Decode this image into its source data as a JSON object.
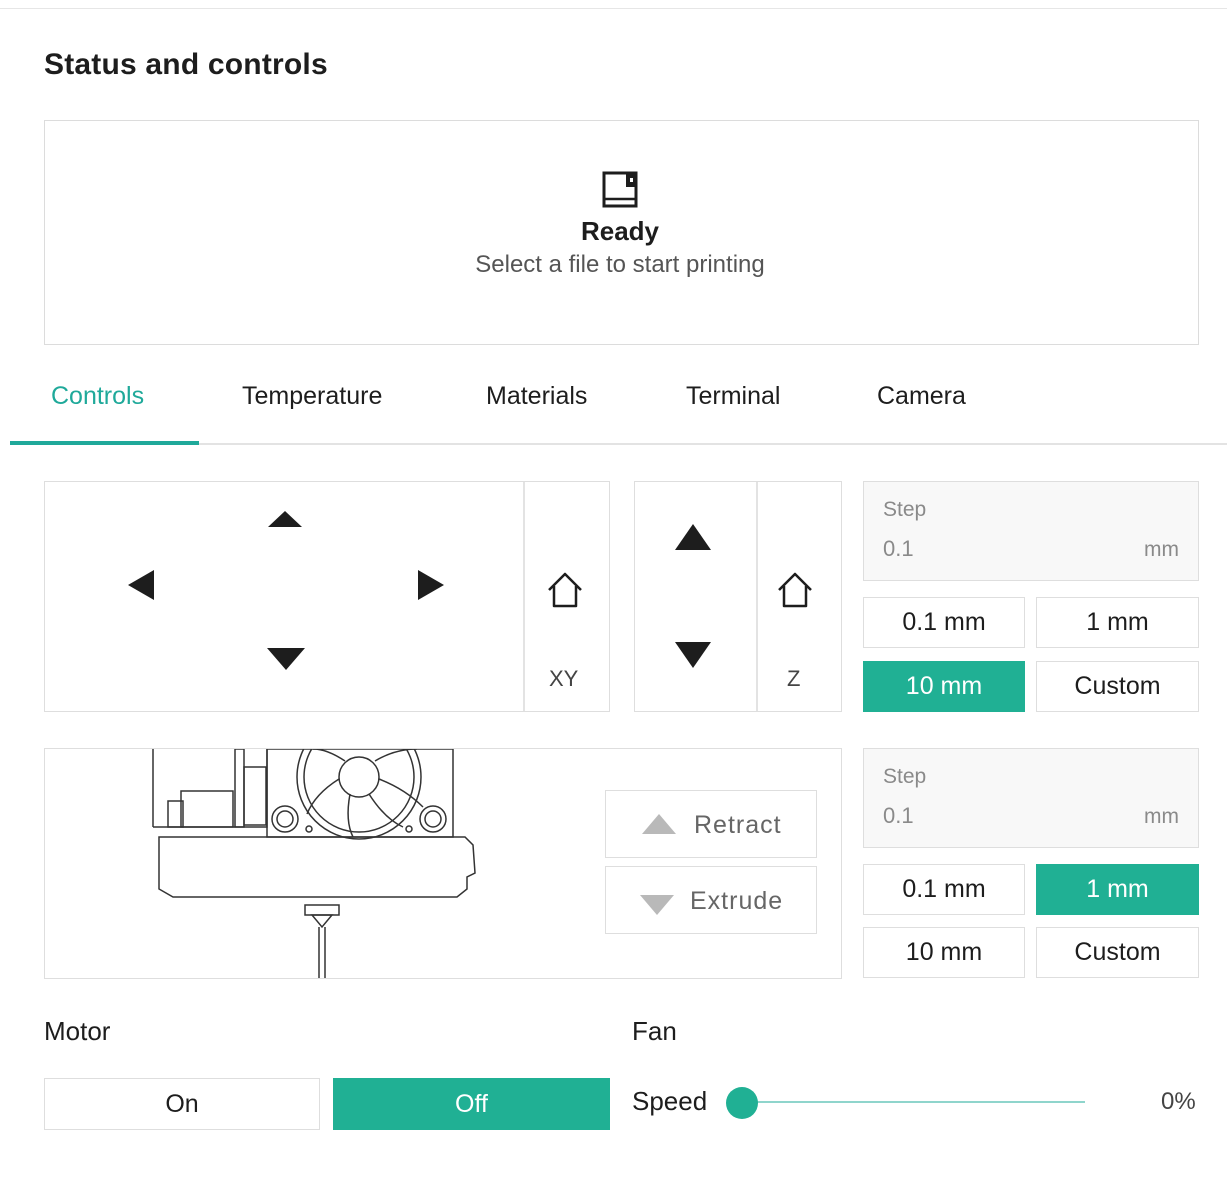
{
  "page": {
    "title": "Status and controls"
  },
  "status": {
    "title": "Ready",
    "subtitle": "Select a file to start printing",
    "icon": "printer-icon"
  },
  "tabs": [
    {
      "label": "Controls",
      "active": true
    },
    {
      "label": "Temperature",
      "active": false
    },
    {
      "label": "Materials",
      "active": false
    },
    {
      "label": "Terminal",
      "active": false
    },
    {
      "label": "Camera",
      "active": false
    }
  ],
  "xy_jog": {
    "home_label": "XY"
  },
  "z_jog": {
    "home_label": "Z"
  },
  "move_step": {
    "label": "Step",
    "value": "0.1",
    "unit": "mm",
    "options": [
      "0.1 mm",
      "1 mm",
      "10 mm",
      "Custom"
    ],
    "selected": "10 mm"
  },
  "extruder": {
    "retract_label": "Retract",
    "extrude_label": "Extrude"
  },
  "extrude_step": {
    "label": "Step",
    "value": "0.1",
    "unit": "mm",
    "options": [
      "0.1 mm",
      "1 mm",
      "10 mm",
      "Custom"
    ],
    "selected": "1 mm"
  },
  "motor": {
    "label": "Motor",
    "on_label": "On",
    "off_label": "Off",
    "state": "Off"
  },
  "fan": {
    "label": "Fan",
    "speed_label": "Speed",
    "speed_value": "0%",
    "speed_fraction": 0
  },
  "colors": {
    "accent": "#20b094",
    "tab_active": "#1fa99a",
    "border": "#dedede"
  }
}
